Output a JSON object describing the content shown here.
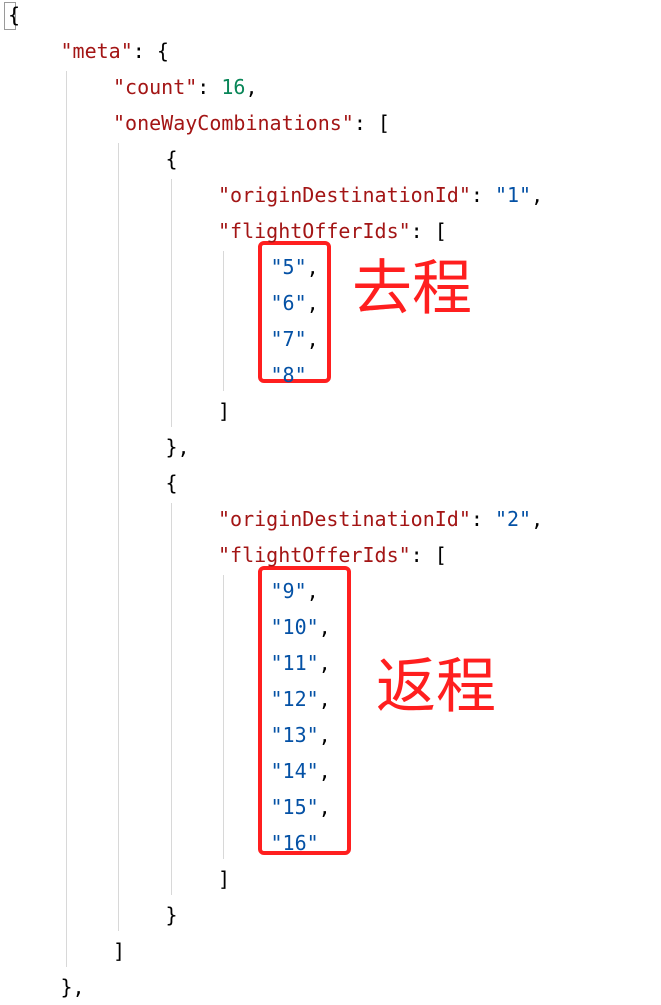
{
  "json_view": {
    "lines": [
      {
        "indent": 0,
        "tokens": [
          {
            "t": "punc",
            "v": "{"
          }
        ]
      },
      {
        "indent": 1,
        "tokens": [
          {
            "t": "key",
            "v": "\"meta\""
          },
          {
            "t": "punc",
            "v": ": {"
          }
        ]
      },
      {
        "indent": 2,
        "tokens": [
          {
            "t": "key",
            "v": "\"count\""
          },
          {
            "t": "punc",
            "v": ": "
          },
          {
            "t": "num",
            "v": "16"
          },
          {
            "t": "punc",
            "v": ","
          }
        ]
      },
      {
        "indent": 2,
        "tokens": [
          {
            "t": "key",
            "v": "\"oneWayCombinations\""
          },
          {
            "t": "punc",
            "v": ": ["
          }
        ]
      },
      {
        "indent": 3,
        "tokens": [
          {
            "t": "punc",
            "v": "{"
          }
        ]
      },
      {
        "indent": 4,
        "tokens": [
          {
            "t": "key",
            "v": "\"originDestinationId\""
          },
          {
            "t": "punc",
            "v": ": "
          },
          {
            "t": "str",
            "v": "\"1\""
          },
          {
            "t": "punc",
            "v": ","
          }
        ]
      },
      {
        "indent": 4,
        "tokens": [
          {
            "t": "key",
            "v": "\"flightOfferIds\""
          },
          {
            "t": "punc",
            "v": ": ["
          }
        ]
      },
      {
        "indent": 5,
        "tokens": [
          {
            "t": "str",
            "v": "\"5\""
          },
          {
            "t": "punc",
            "v": ","
          }
        ]
      },
      {
        "indent": 5,
        "tokens": [
          {
            "t": "str",
            "v": "\"6\""
          },
          {
            "t": "punc",
            "v": ","
          }
        ]
      },
      {
        "indent": 5,
        "tokens": [
          {
            "t": "str",
            "v": "\"7\""
          },
          {
            "t": "punc",
            "v": ","
          }
        ]
      },
      {
        "indent": 5,
        "tokens": [
          {
            "t": "str",
            "v": "\"8\""
          }
        ]
      },
      {
        "indent": 4,
        "tokens": [
          {
            "t": "punc",
            "v": "]"
          }
        ]
      },
      {
        "indent": 3,
        "tokens": [
          {
            "t": "punc",
            "v": "},"
          }
        ]
      },
      {
        "indent": 3,
        "tokens": [
          {
            "t": "punc",
            "v": "{"
          }
        ]
      },
      {
        "indent": 4,
        "tokens": [
          {
            "t": "key",
            "v": "\"originDestinationId\""
          },
          {
            "t": "punc",
            "v": ": "
          },
          {
            "t": "str",
            "v": "\"2\""
          },
          {
            "t": "punc",
            "v": ","
          }
        ]
      },
      {
        "indent": 4,
        "tokens": [
          {
            "t": "key",
            "v": "\"flightOfferIds\""
          },
          {
            "t": "punc",
            "v": ": ["
          }
        ]
      },
      {
        "indent": 5,
        "tokens": [
          {
            "t": "str",
            "v": "\"9\""
          },
          {
            "t": "punc",
            "v": ","
          }
        ]
      },
      {
        "indent": 5,
        "tokens": [
          {
            "t": "str",
            "v": "\"10\""
          },
          {
            "t": "punc",
            "v": ","
          }
        ]
      },
      {
        "indent": 5,
        "tokens": [
          {
            "t": "str",
            "v": "\"11\""
          },
          {
            "t": "punc",
            "v": ","
          }
        ]
      },
      {
        "indent": 5,
        "tokens": [
          {
            "t": "str",
            "v": "\"12\""
          },
          {
            "t": "punc",
            "v": ","
          }
        ]
      },
      {
        "indent": 5,
        "tokens": [
          {
            "t": "str",
            "v": "\"13\""
          },
          {
            "t": "punc",
            "v": ","
          }
        ]
      },
      {
        "indent": 5,
        "tokens": [
          {
            "t": "str",
            "v": "\"14\""
          },
          {
            "t": "punc",
            "v": ","
          }
        ]
      },
      {
        "indent": 5,
        "tokens": [
          {
            "t": "str",
            "v": "\"15\""
          },
          {
            "t": "punc",
            "v": ","
          }
        ]
      },
      {
        "indent": 5,
        "tokens": [
          {
            "t": "str",
            "v": "\"16\""
          }
        ]
      },
      {
        "indent": 4,
        "tokens": [
          {
            "t": "punc",
            "v": "]"
          }
        ]
      },
      {
        "indent": 3,
        "tokens": [
          {
            "t": "punc",
            "v": "}"
          }
        ]
      },
      {
        "indent": 2,
        "tokens": [
          {
            "t": "punc",
            "v": "]"
          }
        ]
      },
      {
        "indent": 1,
        "tokens": [
          {
            "t": "punc",
            "v": "},"
          }
        ]
      }
    ]
  },
  "annotations": {
    "outbound_label": "去程",
    "return_label": "返程"
  },
  "colors": {
    "key": "#a31515",
    "number": "#098658",
    "string": "#0451a5",
    "punctuation": "#000000",
    "highlight": "#ff1f1f",
    "indent_guide": "#d8d8d8"
  }
}
